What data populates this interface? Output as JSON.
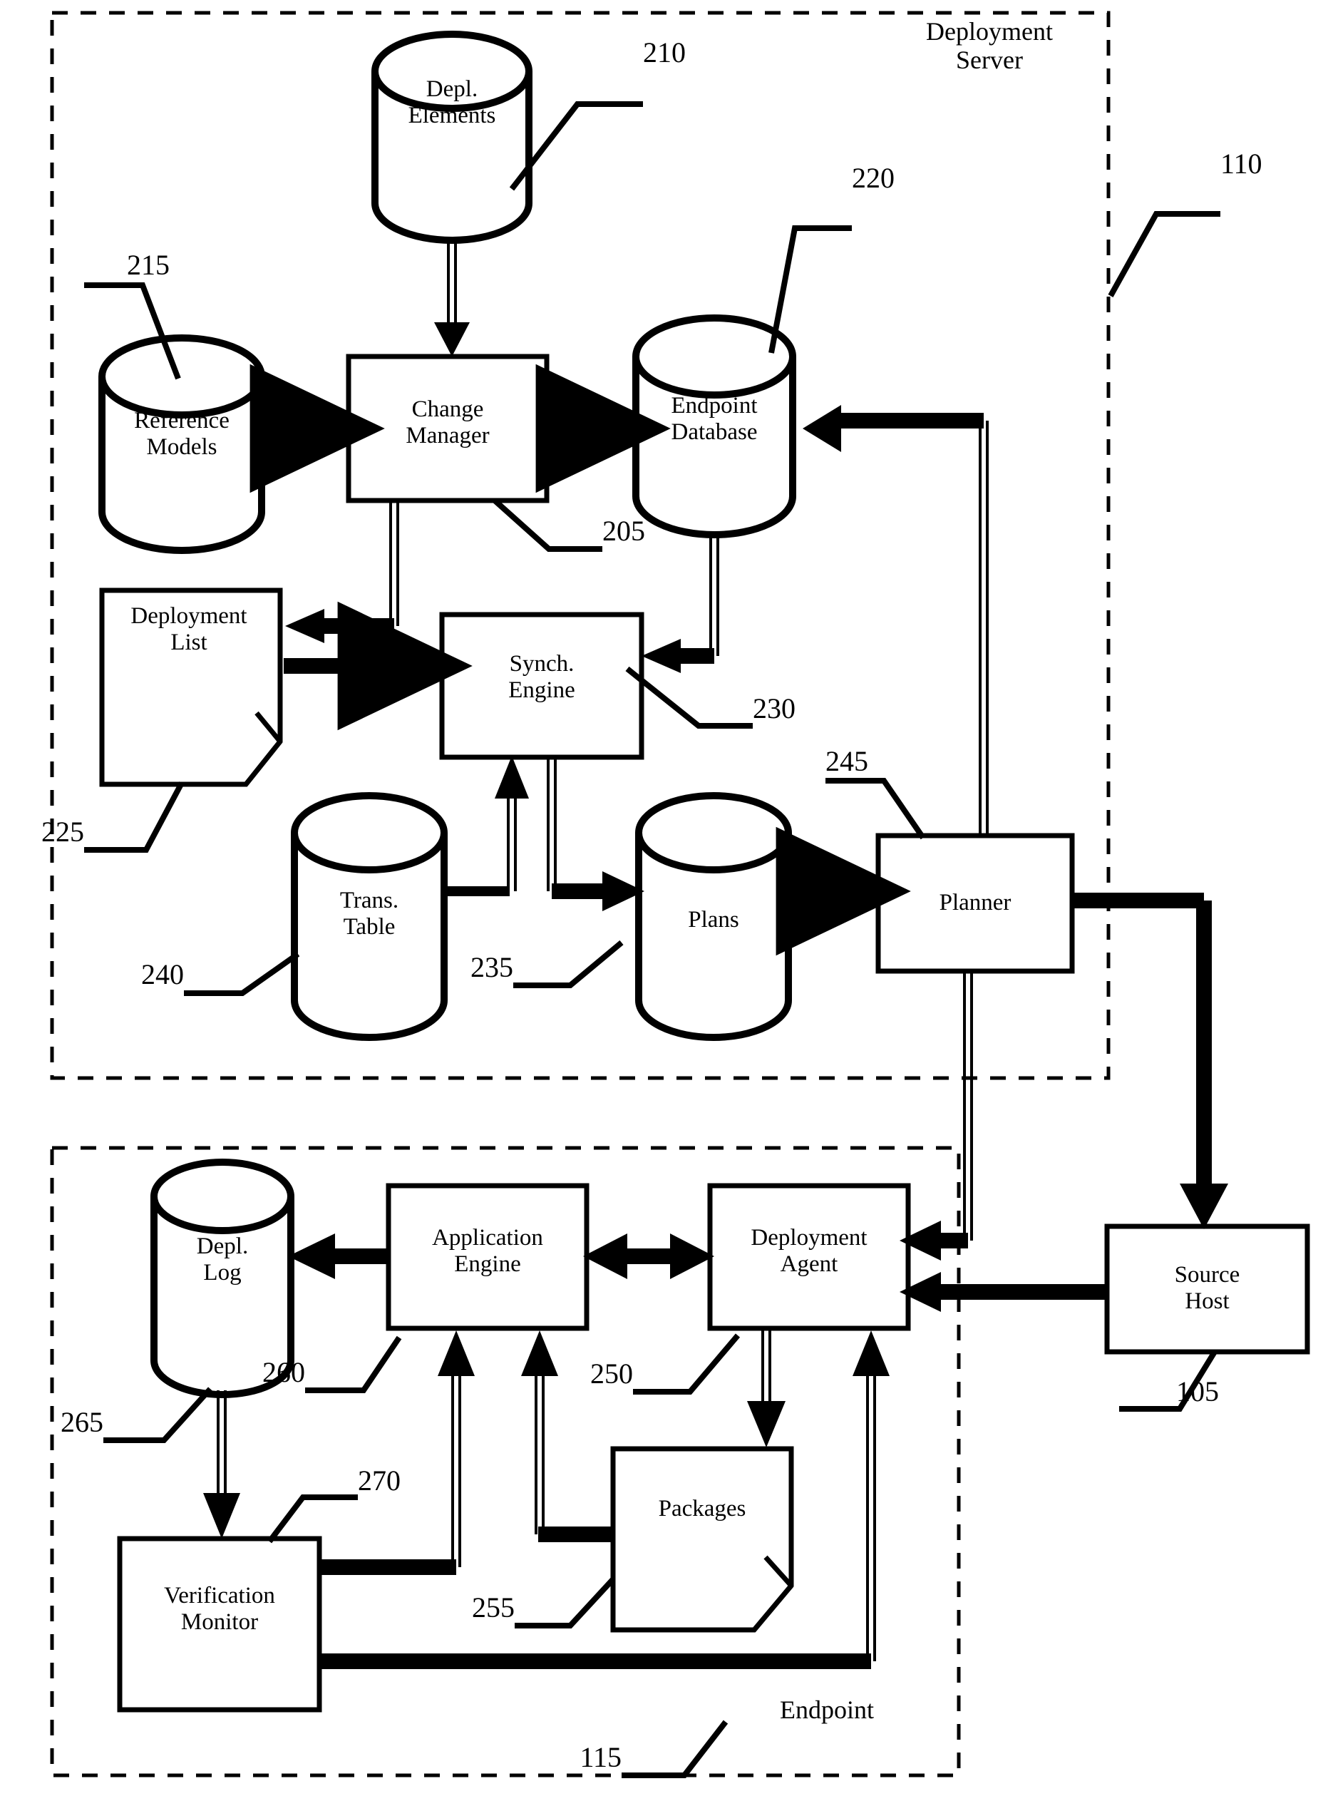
{
  "figure": {
    "zones": [
      {
        "id": "deployment-server",
        "label": "Deployment\nServer",
        "ref": "110"
      },
      {
        "id": "endpoint",
        "label": "Endpoint",
        "ref": "115"
      }
    ],
    "nodes": [
      {
        "id": "depl-elements",
        "label": "Depl.\nElements",
        "ref": "210",
        "shape": "cylinder"
      },
      {
        "id": "reference-models",
        "label": "Reference\nModels",
        "ref": "215",
        "shape": "cylinder"
      },
      {
        "id": "change-manager",
        "label": "Change\nManager",
        "ref": "205",
        "shape": "box"
      },
      {
        "id": "endpoint-database",
        "label": "Endpoint\nDatabase",
        "ref": "220",
        "shape": "cylinder"
      },
      {
        "id": "deployment-list",
        "label": "Deployment\nList",
        "ref": "225",
        "shape": "document"
      },
      {
        "id": "synch-engine",
        "label": "Synch.\nEngine",
        "ref": "230",
        "shape": "box"
      },
      {
        "id": "trans-table",
        "label": "Trans.\nTable",
        "ref": "240",
        "shape": "cylinder"
      },
      {
        "id": "plans",
        "label": "Plans",
        "ref": "235",
        "shape": "cylinder"
      },
      {
        "id": "planner",
        "label": "Planner",
        "ref": "245",
        "shape": "box"
      },
      {
        "id": "source-host",
        "label": "Source\nHost",
        "ref": "105",
        "shape": "box"
      },
      {
        "id": "depl-log",
        "label": "Depl.\nLog",
        "ref": "265",
        "shape": "cylinder"
      },
      {
        "id": "application-engine",
        "label": "Application\nEngine",
        "ref": "260",
        "shape": "box"
      },
      {
        "id": "deployment-agent",
        "label": "Deployment\nAgent",
        "ref": "250",
        "shape": "box"
      },
      {
        "id": "packages",
        "label": "Packages",
        "ref": "255",
        "shape": "document"
      },
      {
        "id": "verification-monitor",
        "label": "Verification\nMonitor",
        "ref": "270",
        "shape": "box"
      }
    ],
    "ref_numbers": [
      "105",
      "110",
      "115",
      "205",
      "210",
      "215",
      "220",
      "225",
      "230",
      "235",
      "240",
      "245",
      "250",
      "255",
      "260",
      "265",
      "270"
    ]
  }
}
